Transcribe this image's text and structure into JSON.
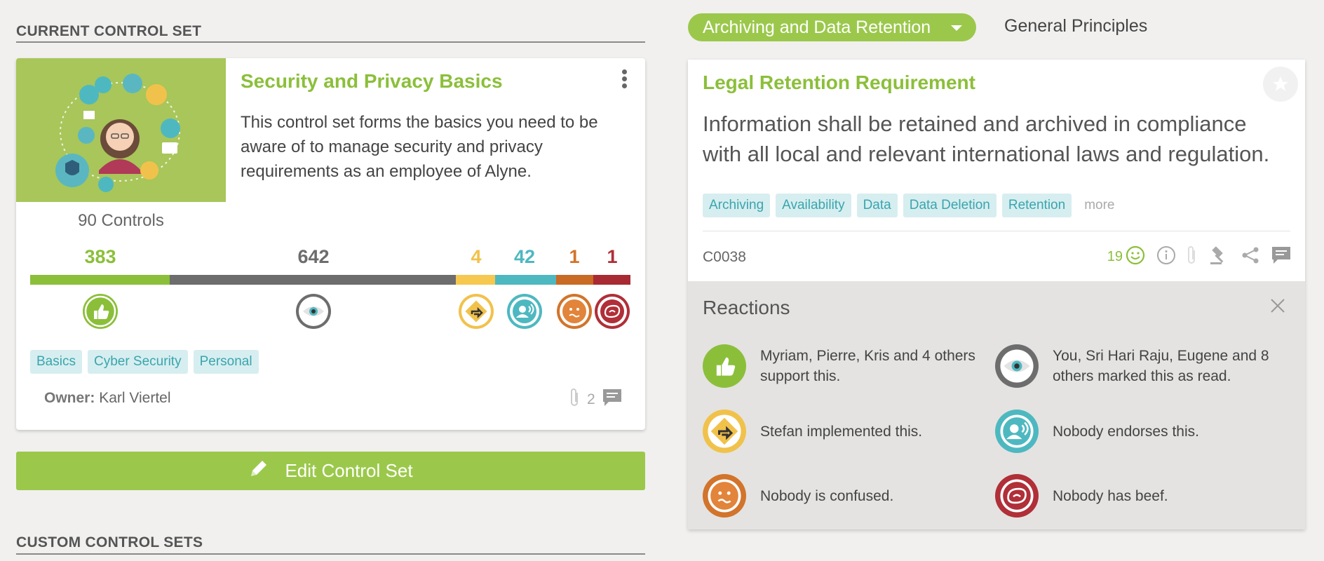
{
  "left": {
    "current_section_title": "CURRENT CONTROL SET",
    "custom_section_title": "CUSTOM CONTROL SETS",
    "card": {
      "title": "Security and Privacy Basics",
      "description": "This control set forms the basics you need to be aware of to manage security and privacy requirements as an employee of Alyne.",
      "controls_count": "90 Controls",
      "stats": [
        {
          "value": "383",
          "color": "#8bbf3a",
          "icon": "thumbs-up-icon"
        },
        {
          "value": "642",
          "color": "#6d6d6d",
          "icon": "eye-icon"
        },
        {
          "value": "4",
          "color": "#f1c24b",
          "icon": "implemented-icon"
        },
        {
          "value": "42",
          "color": "#4eb8c1",
          "icon": "endorse-icon"
        },
        {
          "value": "1",
          "color": "#d2742b",
          "icon": "confused-icon"
        },
        {
          "value": "1",
          "color": "#b02f38",
          "icon": "beef-icon"
        }
      ],
      "tags": [
        "Basics",
        "Cyber Security",
        "Personal"
      ],
      "owner_label": "Owner:",
      "owner_name": "Karl Viertel",
      "comment_count": "2"
    },
    "edit_button_label": "Edit Control Set"
  },
  "right": {
    "category_dropdown": "Archiving and Data Retention",
    "principles_tab": "General Principles",
    "control": {
      "title": "Legal Retention Requirement",
      "description": "Information shall be retained and archived in compliance with all local and relevant international laws and regulation.",
      "tags": [
        "Archiving",
        "Availability",
        "Data",
        "Data Deletion",
        "Retention"
      ],
      "more_label": "more",
      "code": "C0038",
      "reaction_count": "19"
    },
    "reactions": {
      "title": "Reactions",
      "items": [
        {
          "icon": "thumbs-up-icon",
          "text": "Myriam, Pierre, Kris and 4 others support this."
        },
        {
          "icon": "eye-icon",
          "text": "You, Sri Hari Raju, Eugene and 8 others marked this as read."
        },
        {
          "icon": "implemented-icon",
          "text": "Stefan implemented this."
        },
        {
          "icon": "endorse-icon",
          "text": "Nobody endorses this."
        },
        {
          "icon": "confused-icon",
          "text": "Nobody is confused."
        },
        {
          "icon": "beef-icon",
          "text": "Nobody has beef."
        }
      ]
    }
  },
  "colors": {
    "accent_green": "#9bc84b",
    "title_green": "#8bbf3a",
    "tag_bg": "#d7eef0",
    "tag_text": "#3aa5ad"
  }
}
